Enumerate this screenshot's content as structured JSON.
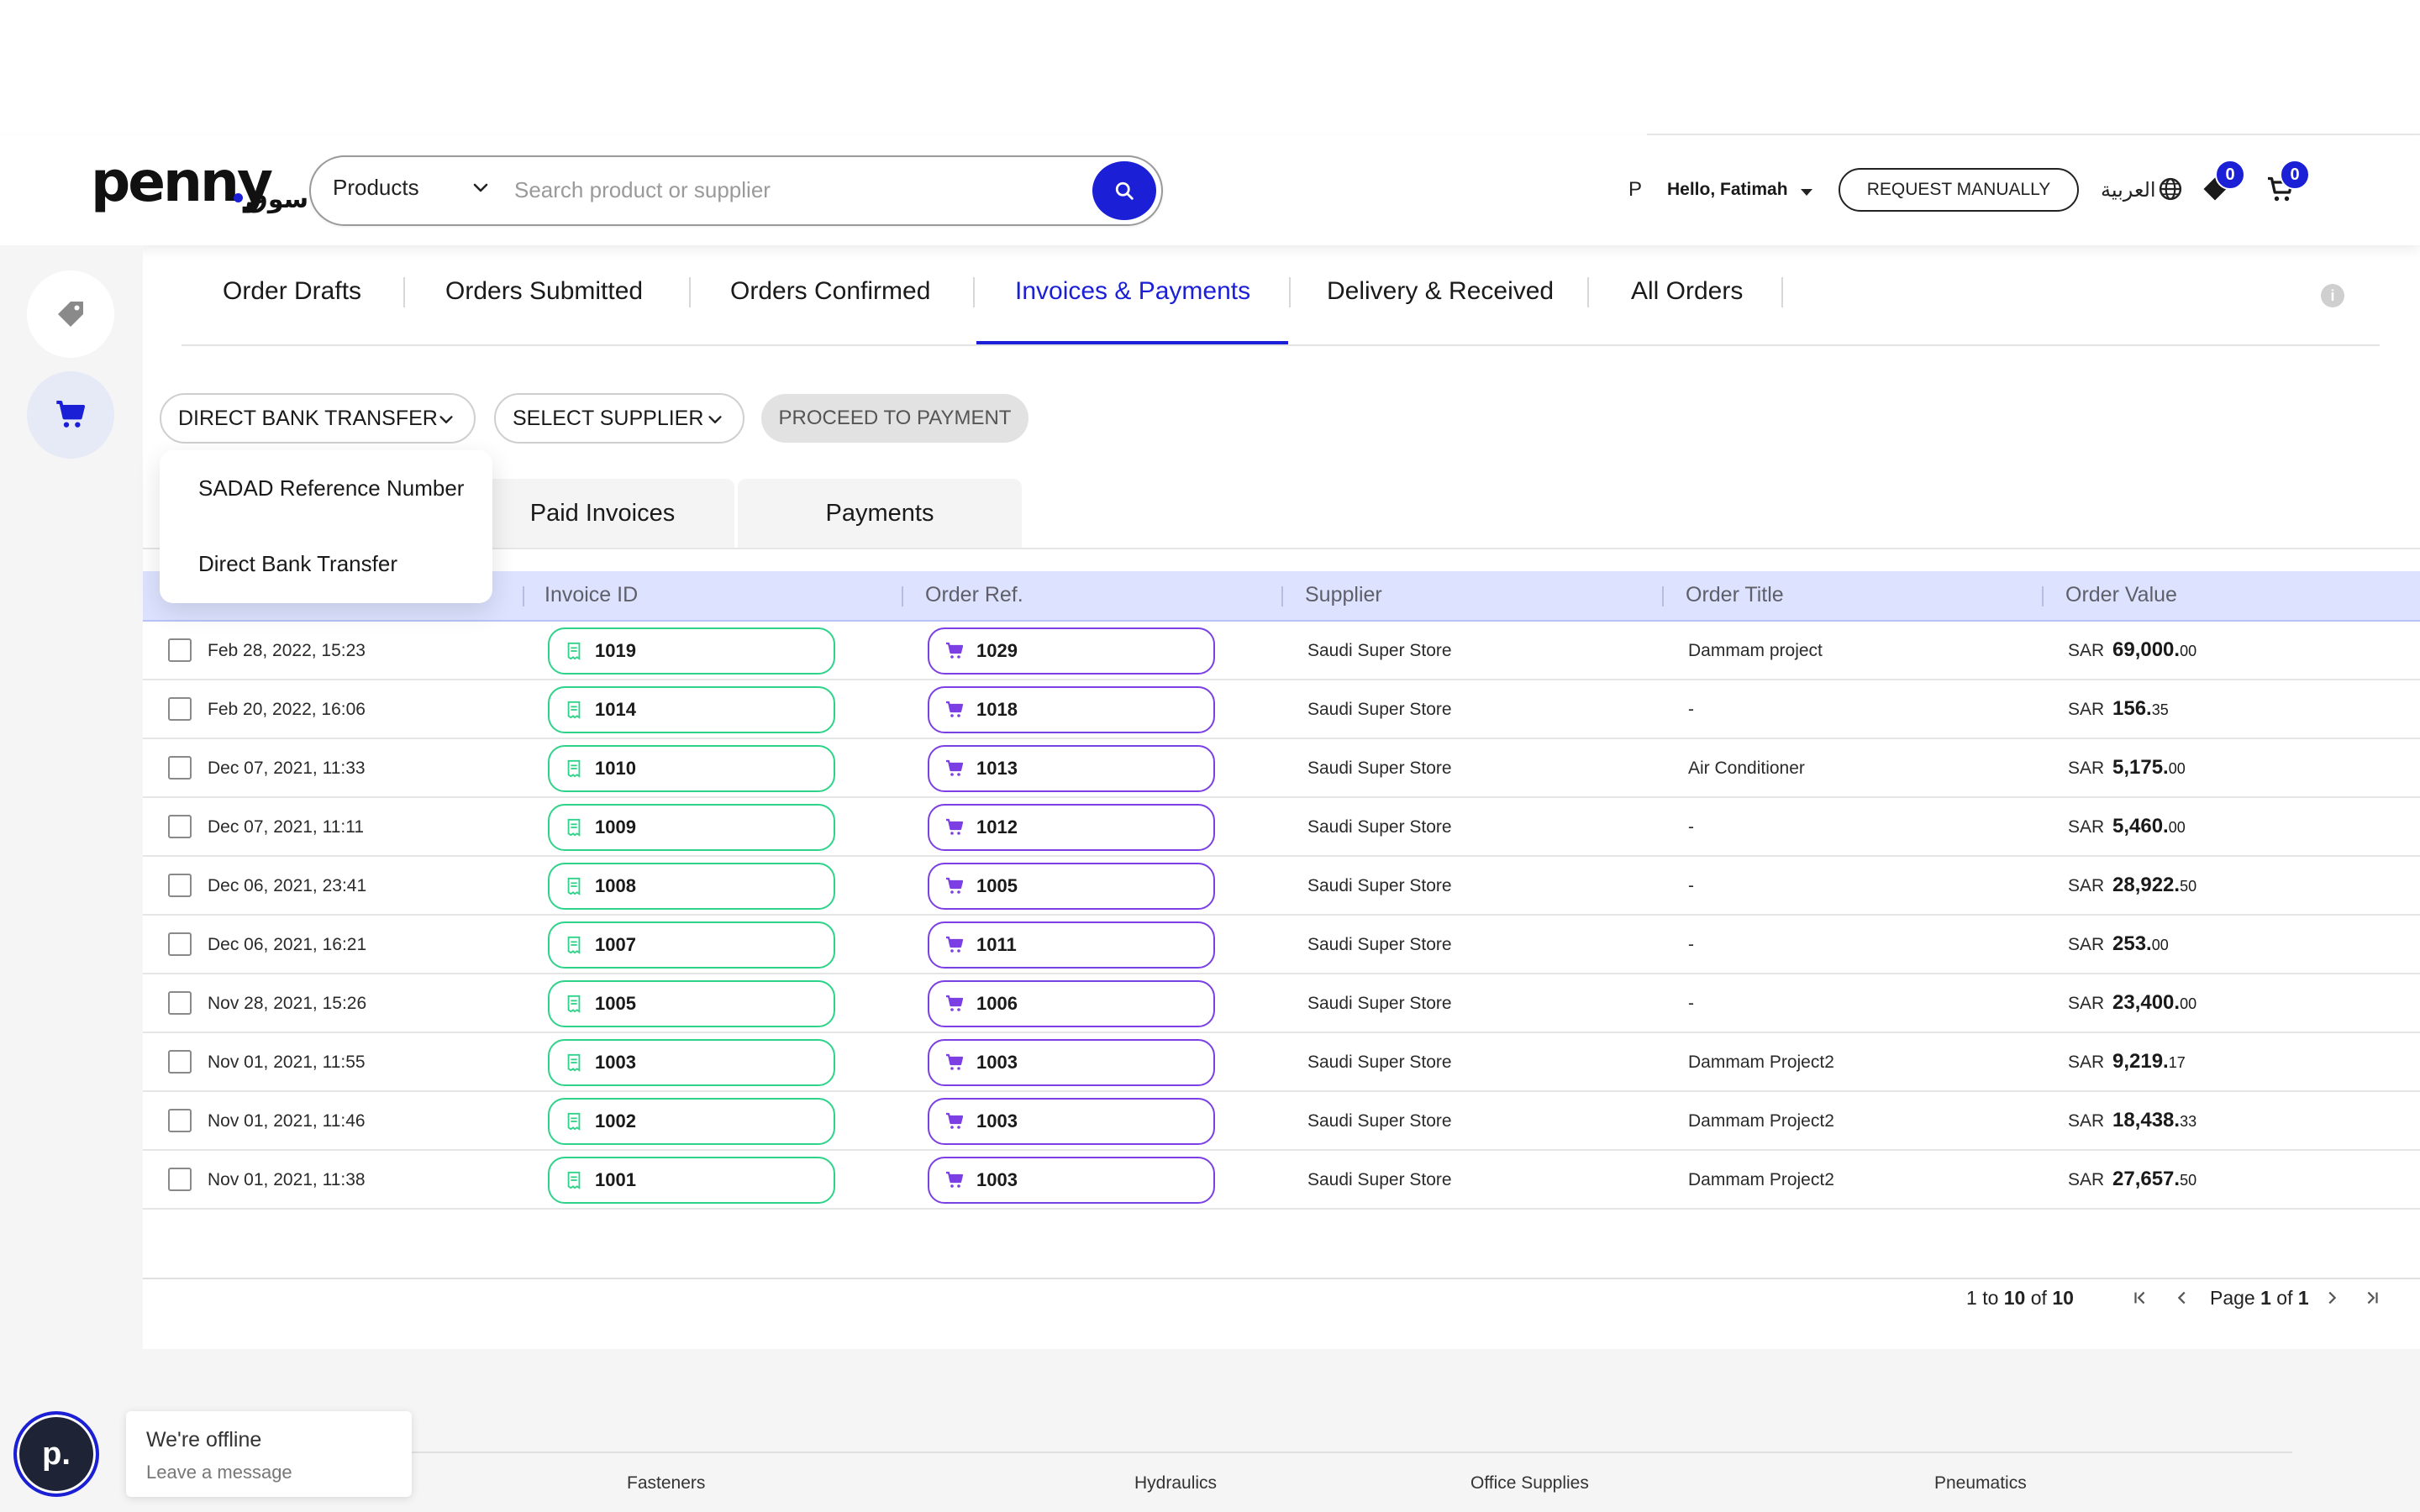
{
  "header": {
    "logo_text": "penny",
    "logo_arabic": "سوق",
    "search_category": "Products",
    "search_placeholder": "Search product or supplier",
    "user_initial": "P",
    "greeting": "Hello, Fatimah",
    "request_button": "REQUEST MANUALLY",
    "language": "العربية",
    "wishlist_count": "0",
    "cart_count": "0"
  },
  "tabs": [
    {
      "label": "Order Drafts"
    },
    {
      "label": "Orders Submitted"
    },
    {
      "label": "Orders Confirmed"
    },
    {
      "label": "Invoices & Payments",
      "active": true
    },
    {
      "label": "Delivery & Received"
    },
    {
      "label": "All Orders"
    }
  ],
  "filters": {
    "payment_method": "DIRECT BANK TRANSFER",
    "supplier": "SELECT SUPPLIER",
    "proceed": "PROCEED TO PAYMENT"
  },
  "dropdown": {
    "options": [
      "SADAD Reference Number",
      "Direct Bank Transfer"
    ]
  },
  "subtabs": [
    "Paid Invoices",
    "Payments"
  ],
  "table": {
    "columns": [
      "Invoice ID",
      "Order Ref.",
      "Supplier",
      "Order Title",
      "Order Value"
    ],
    "currency": "SAR",
    "rows": [
      {
        "date": "Feb 28, 2022, 15:23",
        "invoice": "1019",
        "order": "1029",
        "supplier": "Saudi Super Store",
        "title": "Dammam project",
        "amount": "69,000.",
        "cents": "00"
      },
      {
        "date": "Feb 20, 2022, 16:06",
        "invoice": "1014",
        "order": "1018",
        "supplier": "Saudi Super Store",
        "title": "-",
        "amount": "156.",
        "cents": "35"
      },
      {
        "date": "Dec 07, 2021, 11:33",
        "invoice": "1010",
        "order": "1013",
        "supplier": "Saudi Super Store",
        "title": "Air Conditioner",
        "amount": "5,175.",
        "cents": "00"
      },
      {
        "date": "Dec 07, 2021, 11:11",
        "invoice": "1009",
        "order": "1012",
        "supplier": "Saudi Super Store",
        "title": "-",
        "amount": "5,460.",
        "cents": "00"
      },
      {
        "date": "Dec 06, 2021, 23:41",
        "invoice": "1008",
        "order": "1005",
        "supplier": "Saudi Super Store",
        "title": "-",
        "amount": "28,922.",
        "cents": "50"
      },
      {
        "date": "Dec 06, 2021, 16:21",
        "invoice": "1007",
        "order": "1011",
        "supplier": "Saudi Super Store",
        "title": "-",
        "amount": "253.",
        "cents": "00"
      },
      {
        "date": "Nov 28, 2021, 15:26",
        "invoice": "1005",
        "order": "1006",
        "supplier": "Saudi Super Store",
        "title": "-",
        "amount": "23,400.",
        "cents": "00"
      },
      {
        "date": "Nov 01, 2021, 11:55",
        "invoice": "1003",
        "order": "1003",
        "supplier": "Saudi Super Store",
        "title": "Dammam Project2",
        "amount": "9,219.",
        "cents": "17"
      },
      {
        "date": "Nov 01, 2021, 11:46",
        "invoice": "1002",
        "order": "1003",
        "supplier": "Saudi Super Store",
        "title": "Dammam Project2",
        "amount": "18,438.",
        "cents": "33"
      },
      {
        "date": "Nov 01, 2021, 11:38",
        "invoice": "1001",
        "order": "1003",
        "supplier": "Saudi Super Store",
        "title": "Dammam Project2",
        "amount": "27,657.",
        "cents": "50"
      }
    ]
  },
  "pagination": {
    "range_from": "1",
    "range_to": "10",
    "total": "10",
    "to_word": "to",
    "of_word": "of",
    "page_word": "Page",
    "page_current": "1",
    "page_total": "1"
  },
  "footer": {
    "categories": [
      "Fasteners",
      "Hydraulics",
      "Office Supplies",
      "Pneumatics"
    ]
  },
  "chat": {
    "avatar_letter": "p.",
    "status": "We're offline",
    "action": "Leave a message"
  },
  "colors": {
    "brand": "#1b1fd6",
    "invoice_pill": "#2ed38a",
    "order_pill": "#7b3fe4",
    "table_header": "#dde3ff"
  }
}
